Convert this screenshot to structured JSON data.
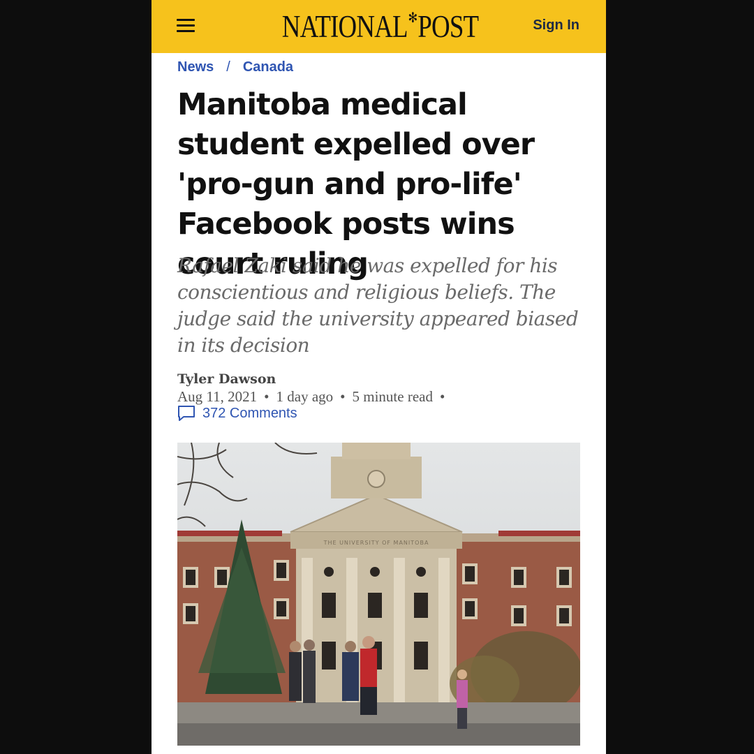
{
  "header": {
    "logo_left": "NATIONAL",
    "logo_right": "POST",
    "signin_label": "Sign In",
    "background": "#f6c21c",
    "menu_icon": "hamburger-menu-icon",
    "logo_mark_icon": "maple-leaf-icon"
  },
  "breadcrumb": {
    "items": [
      "News",
      "Canada"
    ],
    "separator": "/",
    "color": "#2f55b2"
  },
  "article": {
    "headline": "Manitoba medical student expelled over 'pro-gun and pro-life' Facebook posts wins court ruling",
    "deck": "Rafael Zaki said he was expelled for his conscientious and religious beliefs. The judge said the university appeared biased in its decision",
    "author": "Tyler Dawson",
    "date": "Aug 11, 2021",
    "relative_time": "1 day ago",
    "read_time": "5 minute read",
    "meta_separator": "•",
    "comments_label": "372 Comments",
    "comments_icon": "comment-bubble-icon",
    "image_frieze_text": "THE UNIVERSITY OF MANITOBA"
  }
}
